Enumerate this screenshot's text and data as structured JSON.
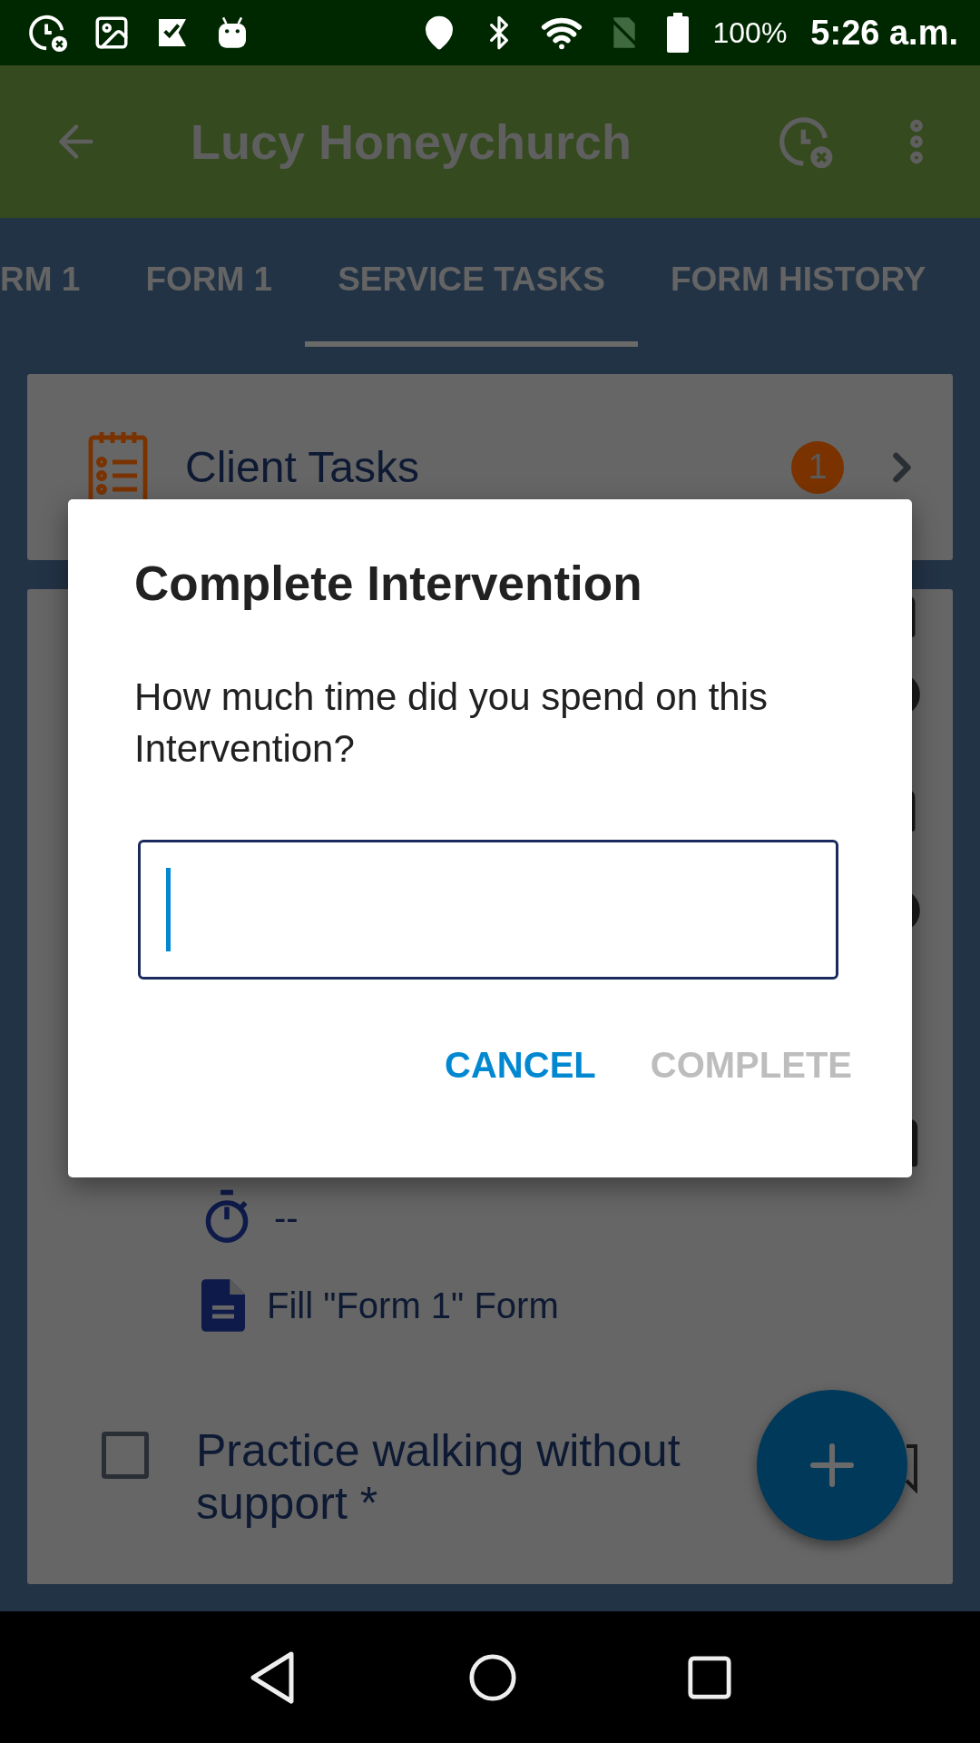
{
  "status_bar": {
    "battery": "100%",
    "time": "5:26 a.m."
  },
  "app_bar": {
    "title": "Lucy Honeychurch"
  },
  "tabs": [
    {
      "label": "RM 1",
      "selected": false
    },
    {
      "label": "FORM 1",
      "selected": false
    },
    {
      "label": "SERVICE TASKS",
      "selected": true
    },
    {
      "label": "FORM HISTORY",
      "selected": false
    }
  ],
  "client_tasks": {
    "title": "Client Tasks",
    "badge": "1"
  },
  "task_list": {
    "tasks": [
      {
        "duration": "--",
        "form_action": "Fill \"Form 1\" Form"
      },
      {
        "checked": false,
        "title": "Practice walking without support *"
      }
    ]
  },
  "dialog": {
    "title": "Complete Intervention",
    "message": "How much time did you spend on this Intervention?",
    "input": {
      "focused": true
    },
    "buttons": [
      {
        "label": "CANCEL",
        "disabled": false
      },
      {
        "label": "COMPLETE",
        "disabled": true
      }
    ]
  }
}
